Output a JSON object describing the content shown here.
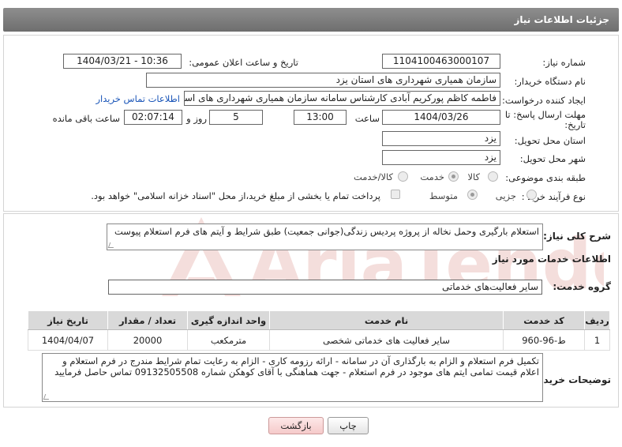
{
  "header": {
    "title": "جزئیات اطلاعات نیاز"
  },
  "fields": {
    "need_number_label": "شماره نیاز:",
    "need_number": "1104100463000107",
    "announce_label": "تاریخ و ساعت اعلان عمومی:",
    "announce_value": "1404/03/21 - 10:36",
    "buyer_org_label": "نام دستگاه خریدار:",
    "buyer_org": "سازمان همیاری شهرداری های استان یزد",
    "requester_label": "ایجاد کننده درخواست:",
    "requester": "فاطمه کاظم پورکریم آبادی کارشناس سامانه سازمان همیاری شهرداری های استان یزد",
    "contact_link": "اطلاعات تماس خریدار",
    "deadline_label_1": "مهلت ارسال پاسخ: تا",
    "deadline_label_2": "تاریخ:",
    "deadline_date": "1404/03/26",
    "time_label": "ساعت",
    "deadline_time": "13:00",
    "days_value": "5",
    "days_label": "روز و",
    "remaining_time": "02:07:14",
    "remaining_label": "ساعت باقی مانده",
    "province_label": "استان محل تحویل:",
    "province": "یزد",
    "city_label": "شهر محل تحویل:",
    "city": "یزد",
    "category_label": "طبقه بندی موضوعی:",
    "category_options": [
      "کالا",
      "خدمت",
      "کالا/خدمت"
    ],
    "process_label": "نوع فرآیند خرید :",
    "process_options": [
      "جزیی",
      "متوسط"
    ],
    "treasury_note": "پرداخت تمام یا بخشی از مبلغ خرید،از محل \"اسناد خزانه اسلامی\" خواهد بود."
  },
  "description": {
    "label": "شرح کلی نیاز:",
    "text": "استعلام بارگیری وحمل نخاله از پروژه پردیس زندگی(جوانی جمعیت) طبق شرایط و آیتم های فرم استعلام پیوست"
  },
  "services": {
    "section_title": "اطلاعات خدمات مورد نیاز",
    "group_label": "گروه خدمت:",
    "group_value": "سایر فعالیت‌های خدماتی",
    "columns": [
      "ردیف",
      "کد خدمت",
      "نام خدمت",
      "واحد اندازه گیری",
      "تعداد / مقدار",
      "تاریخ نیاز"
    ],
    "rows": [
      {
        "row": "1",
        "code": "ط-96-960",
        "name": "سایر فعالیت های خدماتی شخصی",
        "unit": "مترمکعب",
        "qty": "20000",
        "date": "1404/04/07"
      }
    ]
  },
  "buyer_notes": {
    "label": "توضیحات خریدار:",
    "text": "تکمیل فرم استعلام و الزام به بارگذاری آن در سامانه - ارائه رزومه کاری - الزام به رعایت تمام شرایط مندرج در فرم استعلام و اعلام قیمت تمامی ایتم های موجود در فرم استعلام - جهت هماهنگی با آقای کوهکن شماره 09132505508 تماس حاصل فرمایید"
  },
  "buttons": {
    "print": "چاپ",
    "back": "بازگشت"
  },
  "watermark": {
    "text": "AriaTender.neT"
  },
  "colors": {
    "header": "#7a7a7a",
    "link": "#1a55b8",
    "watermark": "#c0392b"
  }
}
